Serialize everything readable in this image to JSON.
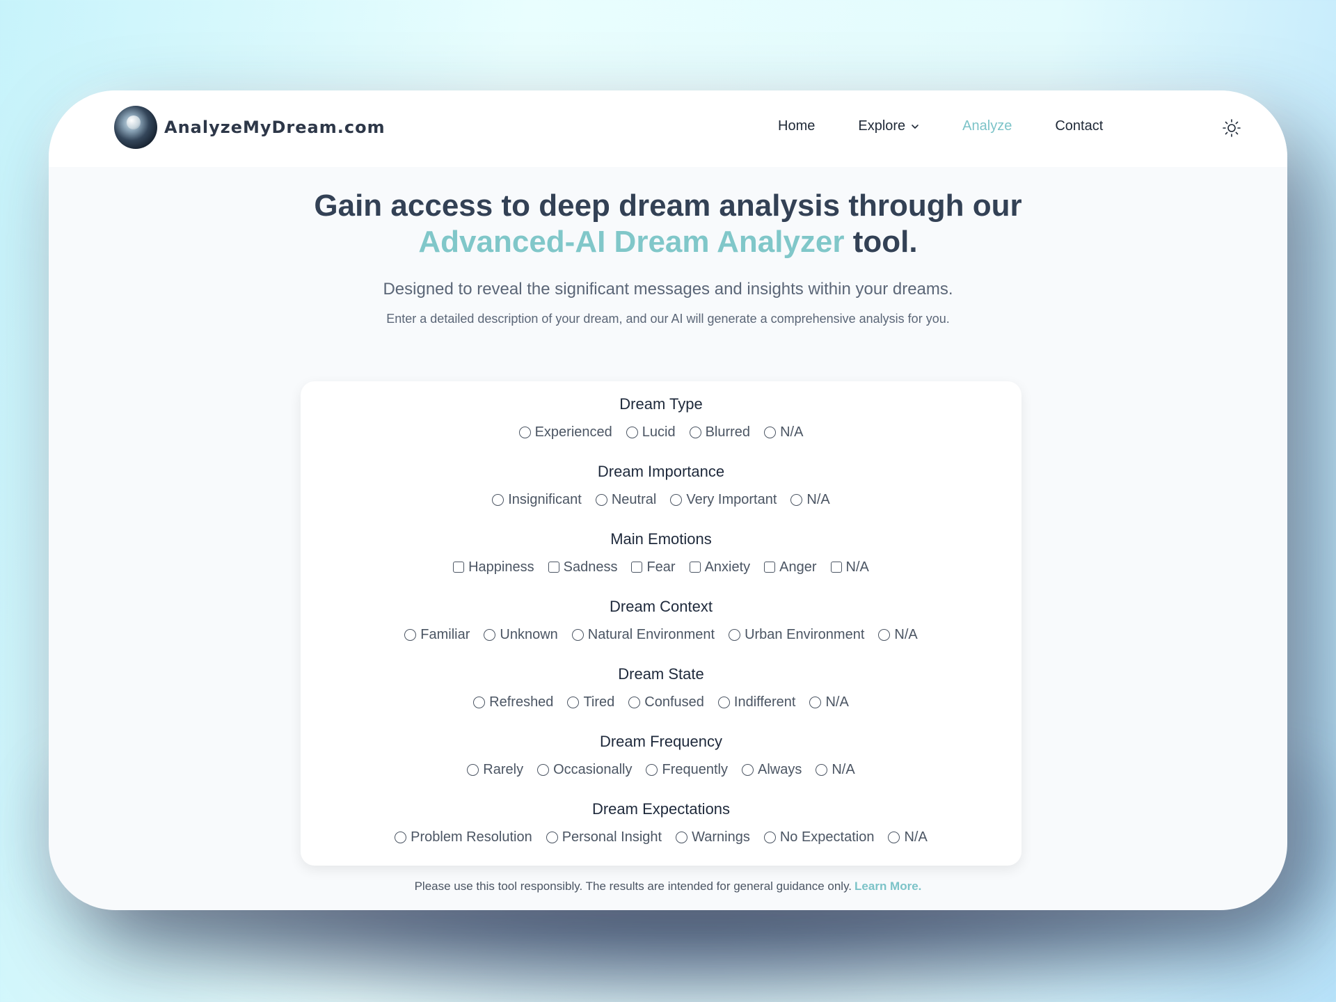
{
  "nav": {
    "brand": "AnalyzeMyDream.com",
    "items": [
      {
        "label": "Home"
      },
      {
        "label": "Explore"
      },
      {
        "label": "Analyze"
      },
      {
        "label": "Contact"
      }
    ]
  },
  "hero": {
    "title_part1": "Gain access to deep dream analysis through our",
    "title_accent": "Advanced-AI Dream Analyzer",
    "title_tail": "tool.",
    "subtitle": "Designed to reveal the significant messages and insights within your dreams.",
    "description": "Enter a detailed description of your dream, and our AI will generate a comprehensive analysis for you."
  },
  "form": {
    "groups": [
      {
        "title": "Dream Type",
        "options": [
          "Experienced",
          "Lucid",
          "Blurred",
          "N/A"
        ]
      },
      {
        "title": "Dream Importance",
        "options": [
          "Insignificant",
          "Neutral",
          "Very Important",
          "N/A"
        ]
      },
      {
        "title": "Main Emotions",
        "options": [
          "Happiness",
          "Sadness",
          "Fear",
          "Anxiety",
          "Anger",
          "N/A"
        ]
      },
      {
        "title": "Dream Context",
        "options": [
          "Familiar",
          "Unknown",
          "Natural Environment",
          "Urban Environment",
          "N/A"
        ]
      },
      {
        "title": "Dream State",
        "options": [
          "Refreshed",
          "Tired",
          "Confused",
          "Indifferent",
          "N/A"
        ]
      },
      {
        "title": "Dream Frequency",
        "options": [
          "Rarely",
          "Occasionally",
          "Frequently",
          "Always",
          "N/A"
        ]
      },
      {
        "title": "Dream Expectations",
        "options": [
          "Problem Resolution",
          "Personal Insight",
          "Warnings",
          "No Expectation",
          "N/A"
        ]
      }
    ]
  },
  "footer": {
    "note": "Please use this tool responsibly. The results are intended for general guidance only.",
    "link": "Learn More."
  },
  "colors": {
    "accent": "#7cc3c8",
    "heading": "#334155"
  }
}
